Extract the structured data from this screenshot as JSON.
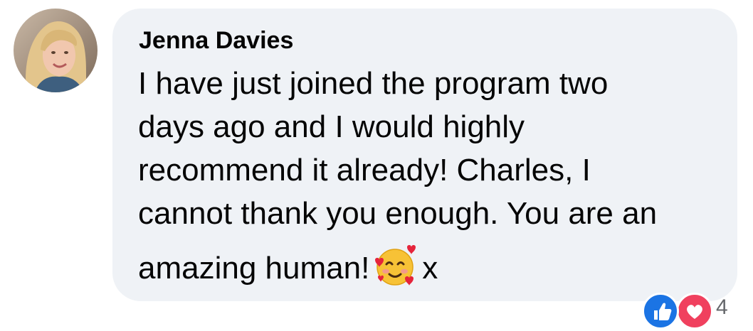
{
  "comment": {
    "author": "Jenna Davies",
    "lines": [
      "I have just joined the program two",
      "days ago and I would highly",
      "recommend it already! Charles, I",
      "cannot thank you enough. You are an",
      "amazing human!"
    ],
    "trailing_text": "x",
    "emoji": "smiling-face-with-hearts",
    "avatar": "profile-photo"
  },
  "reactions": {
    "icons": [
      "like-icon",
      "love-icon"
    ],
    "count": "4"
  },
  "colors": {
    "bubble_background": "#eff2f6",
    "text": "#050505",
    "like": "#1b74e4",
    "love": "#f0405e"
  }
}
